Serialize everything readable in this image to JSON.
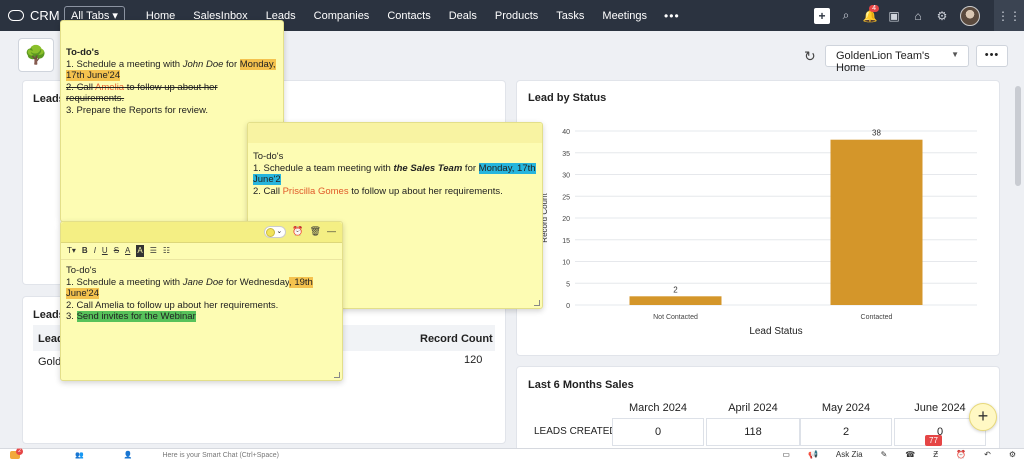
{
  "nav": {
    "brand": "CRM",
    "all_tabs": "All Tabs",
    "items": [
      "Home",
      "SalesInbox",
      "Leads",
      "Companies",
      "Contacts",
      "Deals",
      "Products",
      "Tasks",
      "Meetings"
    ],
    "more": "•••",
    "notification_count": "4"
  },
  "home": {
    "selector": "GoldenLion Team's Home",
    "more": "•••"
  },
  "panels": {
    "leads_title_top": "Leads",
    "leads_title_mid": "Leads",
    "table_lead_col": "Lead",
    "table_record_count": "Record Count",
    "row_label": "Gold",
    "row_value": "120",
    "sales_title": "Last 6 Months Sales"
  },
  "chart_data": {
    "type": "bar",
    "title": "Lead by Status",
    "xlabel": "Lead Status",
    "ylabel": "Record Count",
    "categories": [
      "Not Contacted",
      "Contacted"
    ],
    "values": [
      2,
      38
    ],
    "ylim": [
      0,
      40
    ],
    "yticks": [
      0,
      5,
      10,
      15,
      20,
      25,
      30,
      35,
      40
    ],
    "bar_color": "#d4962a",
    "grid": true
  },
  "sales": {
    "months": [
      "March 2024",
      "April 2024",
      "May 2024",
      "June 2024"
    ],
    "row_label": "LEADS CREATED",
    "values": [
      "0",
      "118",
      "2",
      "0"
    ]
  },
  "notes": {
    "note1": {
      "title": "To-do's",
      "l1_pre": "1.  Schedule a meeting with ",
      "l1_name": "John Doe",
      "l1_mid": " for ",
      "l1_date": "Monday, 17th June'24",
      "l2_num": "2.  ",
      "l2_call": "Call ",
      "l2_name": "Amelia",
      "l2_rest": " to follow up about her requirements.",
      "l3": "3.  Prepare the Reports for review."
    },
    "note2": {
      "title": "To-do's",
      "l1_pre": "1.  Schedule a team meeting with ",
      "l1_team": "the Sales Team",
      "l1_mid": " for ",
      "l1_date": "Monday, 17th June'2",
      "l2_pre": "2.  Call ",
      "l2_name": "Priscilla Gomes",
      "l2_rest": " to follow up about her requirements."
    },
    "note3": {
      "title": "To-do's",
      "l1_pre": "1.  Schedule a meeting with ",
      "l1_name": "Jane Doe",
      "l1_mid": " for Wednesday",
      "l1_date": ", 19th June'24",
      "l2": "2.  Call Amelia to follow up about her requirements.",
      "l3_num": "3.  ",
      "l3_hl": "Send invites for the Webinar"
    },
    "toolbar": [
      "T▾",
      "B",
      "I",
      "U",
      "S",
      "A",
      "A",
      "☰",
      "☷"
    ]
  },
  "bottom": {
    "chat_placeholder": "Here is your Smart Chat (Ctrl+Space)",
    "ask_zia": "Ask Zia",
    "badge": "77"
  }
}
